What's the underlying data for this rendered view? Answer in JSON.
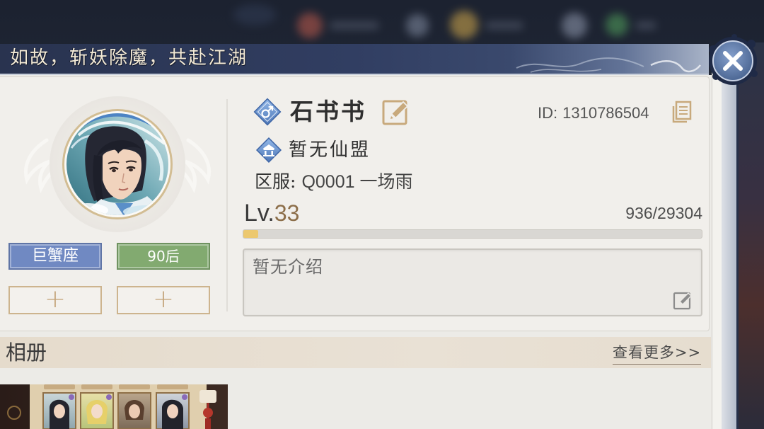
{
  "banner": {
    "motto": "如故，斩妖除魔，共赴江湖"
  },
  "close_button": {
    "icon": "close-icon"
  },
  "profile": {
    "avatar_icon": "avatar-portrait",
    "gender_icon": "male-icon",
    "name": "石书书",
    "name_edit_icon": "pencil-icon",
    "id_label": "ID:",
    "id_value": "1310786504",
    "copy_icon": "copy-icon",
    "guild_icon": "guild-icon",
    "guild": "暂无仙盟",
    "server_label": "区服:",
    "server_value": "Q0001 一场雨",
    "level_prefix": "Lv.",
    "level": "33",
    "exp_text": "936/29304",
    "exp_progress": 0.032,
    "intro": "暂无介绍",
    "intro_edit_icon": "pencil-icon"
  },
  "tags": [
    {
      "label": "巨蟹座",
      "color": "#7089c2"
    },
    {
      "label": "90后",
      "color": "#82aa70"
    }
  ],
  "add_tag_buttons": [
    {
      "label": "+"
    },
    {
      "label": "+"
    }
  ],
  "album": {
    "title": "相册",
    "more_link": "查看更多>>"
  },
  "colors": {
    "accent_gold": "#c6a97e",
    "exp_fill": "#ecc86f",
    "level_number": "#8c6e49",
    "panel_bg": "#ecebe7",
    "banner_bg": "#2f3b5e"
  }
}
